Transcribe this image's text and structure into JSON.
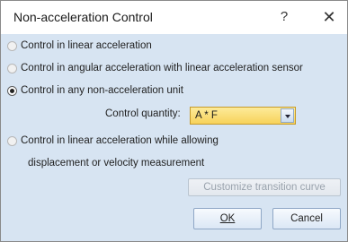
{
  "dialog": {
    "title": "Non-acceleration Control",
    "help": "?",
    "close": "✕"
  },
  "options": {
    "linear": "Control in linear acceleration",
    "angular": "Control in angular acceleration with linear acceleration sensor",
    "nonaccel": "Control in any non-acceleration  unit",
    "allowing_line1": "Control in linear acceleration while allowing",
    "allowing_line2": "displacement or velocity measurement",
    "selected": "nonaccel"
  },
  "control_quantity": {
    "label": "Control quantity:",
    "value": "A * F"
  },
  "buttons": {
    "customize": "Customize transition curve",
    "ok": "OK",
    "cancel": "Cancel"
  }
}
